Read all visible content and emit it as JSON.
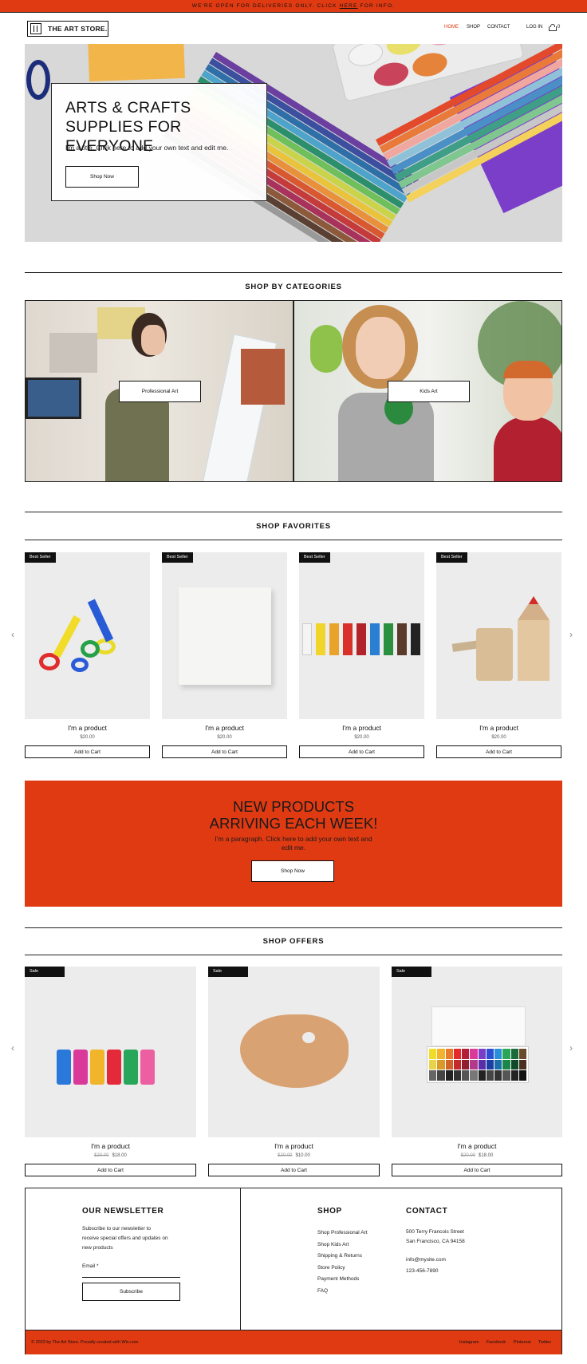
{
  "announcement": {
    "before": "WE'RE OPEN FOR DELIVERIES ONLY. CLICK ",
    "link": "HERE",
    "after": " FOR INFO."
  },
  "header": {
    "logo_text": "THE ART STORE.",
    "nav": [
      "HOME",
      "SHOP",
      "CONTACT"
    ],
    "login": "LOG IN",
    "cart_count": "0"
  },
  "hero": {
    "title": "ARTS & CRAFTS SUPPLIES FOR EVERYONE",
    "subtitle": "I'm a title. Click here to add your own text and edit me.",
    "button": "Shop Now"
  },
  "categories": {
    "title": "SHOP BY CATEGORIES",
    "items": [
      "Professional Art",
      "Kids Art"
    ]
  },
  "favorites": {
    "title": "SHOP FAVORITES",
    "items": [
      {
        "ribbon": "Best Seller",
        "name": "I'm a product",
        "price": "$20.00",
        "button": "Add to Cart"
      },
      {
        "ribbon": "Best Seller",
        "name": "I'm a product",
        "price": "$20.00",
        "button": "Add to Cart"
      },
      {
        "ribbon": "Best Seller",
        "name": "I'm a product",
        "price": "$20.00",
        "button": "Add to Cart"
      },
      {
        "ribbon": "Best Seller",
        "name": "I'm a product",
        "price": "$20.00",
        "button": "Add to Cart"
      }
    ]
  },
  "promo": {
    "title_line1": "NEW PRODUCTS",
    "title_line2": "ARRIVING EACH WEEK!",
    "paragraph": "I'm a paragraph. Click here to add your own text and edit me.",
    "button": "Shop Now"
  },
  "offers": {
    "title": "SHOP OFFERS",
    "items": [
      {
        "ribbon": "Sale",
        "name": "I'm a product",
        "old_price": "$20.00",
        "price": "$18.00",
        "button": "Add to Cart"
      },
      {
        "ribbon": "Sale",
        "name": "I'm a product",
        "old_price": "$20.00",
        "price": "$10.00",
        "button": "Add to Cart"
      },
      {
        "ribbon": "Sale",
        "name": "I'm a product",
        "old_price": "$20.00",
        "price": "$18.00",
        "button": "Add to Cart"
      }
    ]
  },
  "footer": {
    "newsletter_title": "OUR NEWSLETTER",
    "newsletter_text": [
      "Subscribe to our newsletter to",
      "receive special offers and updates on",
      "new products"
    ],
    "email_label": "Email *",
    "subscribe": "Subscribe",
    "shop_title": "SHOP",
    "shop_links": [
      "Shop Professional Art",
      "Shop Kids Art",
      "Shipping & Returns",
      "Store Policy",
      "Payment Methods",
      "FAQ"
    ],
    "contact_title": "CONTACT",
    "address": [
      "500 Terry Francois Street",
      "San Francisco, CA 94158"
    ],
    "email": "info@mysite.com",
    "phone": "123-456-7890",
    "copyright": "© 2023 by The Art Store. Proudly created with Wix.com",
    "social": [
      "Instagram",
      "Facebook",
      "Pinterest",
      "Twitter"
    ]
  },
  "colors": {
    "accent": "#e03a12",
    "ink": "#111111",
    "product_bg": "#ececec"
  }
}
